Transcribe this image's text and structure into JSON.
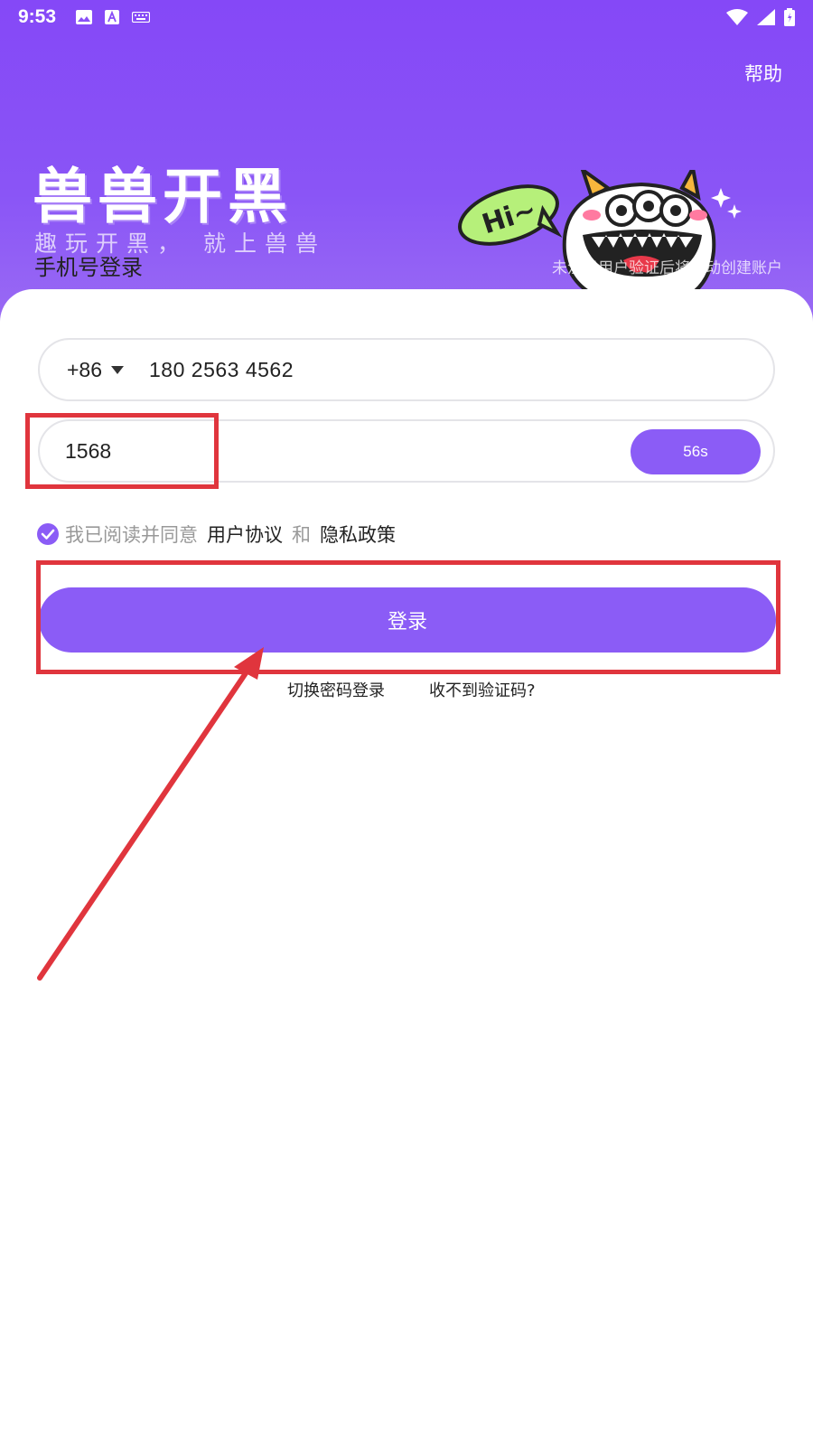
{
  "status_bar": {
    "time": "9:53",
    "left_icons": [
      "image-icon",
      "a-icon",
      "keyboard-icon"
    ],
    "right_icons": [
      "wifi-icon",
      "signal-icon",
      "battery-icon"
    ]
  },
  "header": {
    "help_label": "帮助",
    "app_title": "兽兽开黑",
    "slogan": "趣玩开黑， 就上兽兽",
    "mascot_bubble": "Hi~"
  },
  "login": {
    "title": "手机号登录",
    "auto_create_hint": "未注册用户验证后将自动创建账户",
    "country_code": "+86",
    "phone_value": "180 2563 4562",
    "code_value": "1568",
    "countdown_label": "56s",
    "agree_prefix": "我已阅读并同意",
    "user_agreement": "用户协议",
    "and_text": "和",
    "privacy_policy": "隐私政策",
    "login_button": "登录",
    "switch_password_login": "切换密码登录",
    "no_code_received": "收不到验证码?"
  },
  "colors": {
    "brand_purple": "#8b5cf6",
    "header_purple": "#8548f7",
    "annotation_red": "#e0353d"
  }
}
